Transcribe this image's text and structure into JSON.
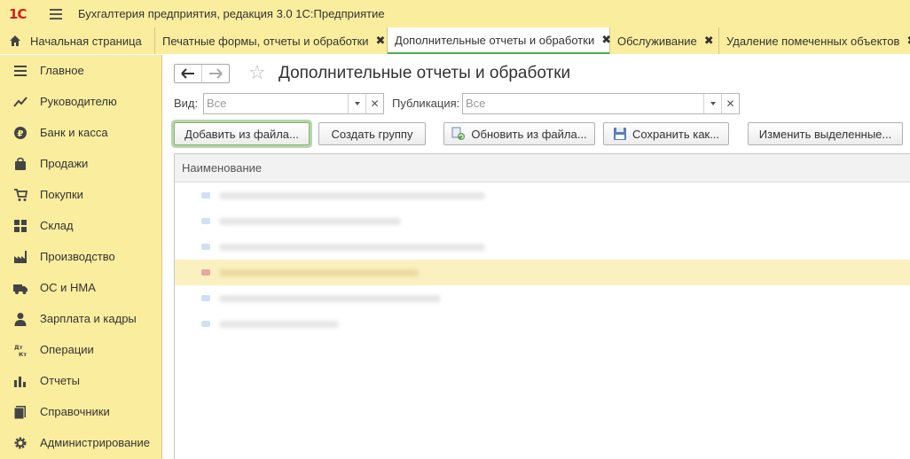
{
  "app": {
    "logo_text": "1С",
    "title": "Бухгалтерия предприятия, редакция 3.0 1С:Предприятие"
  },
  "tabs": [
    {
      "label": "Начальная страница",
      "closable": false
    },
    {
      "label": "Печатные формы, отчеты и обработки",
      "closable": true
    },
    {
      "label": "Дополнительные отчеты и обработки",
      "closable": true,
      "active": true
    },
    {
      "label": "Обслуживание",
      "closable": true
    },
    {
      "label": "Удаление помеченных объектов",
      "closable": true
    }
  ],
  "tab_close_glyph": "✖",
  "sidebar": {
    "items": [
      {
        "label": "Главное",
        "icon": "list-icon"
      },
      {
        "label": "Руководителю",
        "icon": "trend-icon"
      },
      {
        "label": "Банк и касса",
        "icon": "ruble-icon"
      },
      {
        "label": "Продажи",
        "icon": "bag-icon"
      },
      {
        "label": "Покупки",
        "icon": "cart-icon"
      },
      {
        "label": "Склад",
        "icon": "warehouse-icon"
      },
      {
        "label": "Производство",
        "icon": "factory-icon"
      },
      {
        "label": "ОС и НМА",
        "icon": "truck-icon"
      },
      {
        "label": "Зарплата и кадры",
        "icon": "person-icon"
      },
      {
        "label": "Операции",
        "icon": "dt-kt-icon"
      },
      {
        "label": "Отчеты",
        "icon": "bar-chart-icon"
      },
      {
        "label": "Справочники",
        "icon": "book-icon"
      },
      {
        "label": "Администрирование",
        "icon": "gear-icon"
      }
    ]
  },
  "main": {
    "title": "Дополнительные отчеты и обработки",
    "filters": {
      "kind_label": "Вид:",
      "kind_value": "Все",
      "publication_label": "Публикация:",
      "publication_value": "Все"
    },
    "buttons": {
      "add_from_file": "Добавить из файла...",
      "create_group": "Создать группу",
      "update_from_file": "Обновить из файла...",
      "save_as": "Сохранить как...",
      "edit_selected": "Изменить выделенные..."
    },
    "grid": {
      "column_header": "Наименование",
      "rows": [
        {
          "text": "",
          "selected": false
        },
        {
          "text": "",
          "selected": false
        },
        {
          "text": "",
          "selected": false
        },
        {
          "text": "",
          "selected": true
        },
        {
          "text": "",
          "selected": false
        },
        {
          "text": "",
          "selected": false
        }
      ]
    }
  },
  "colors": {
    "panel_yellow": "#fbed9e",
    "logo_red": "#d2201c",
    "focus_green": "#4caf50",
    "selected_row": "#fbf0c0"
  }
}
